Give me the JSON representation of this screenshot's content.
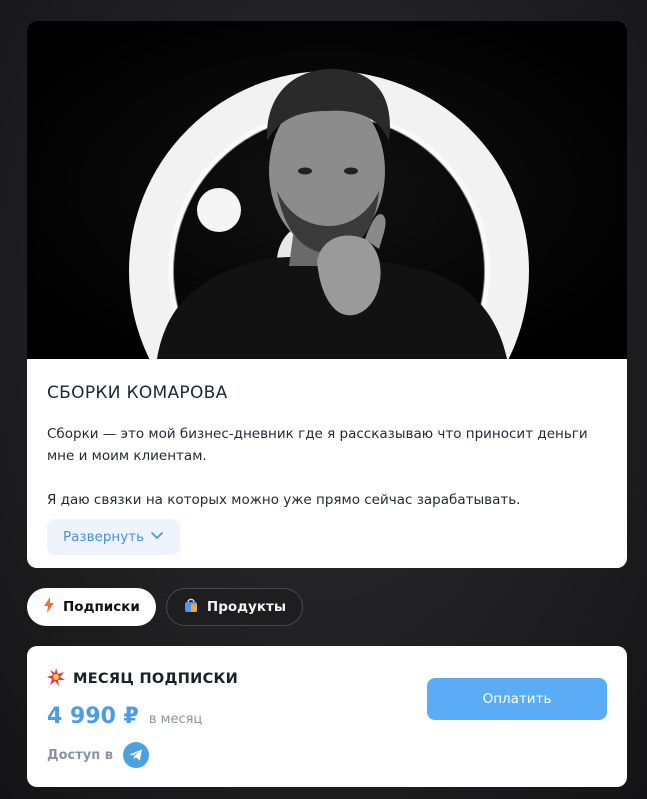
{
  "channel": {
    "title": "СБОРКИ КОМАРОВА",
    "description": "Сборки — это мой бизнес-дневник где я рассказываю что приносит деньги мне и моим клиентам.\n\nЯ даю связки на которых можно уже прямо сейчас зарабатывать.",
    "expand_label": "Развернуть",
    "cover_image": "portrait-photo"
  },
  "tabs": [
    {
      "label": "Подписки",
      "icon": "lightning-icon",
      "active": true
    },
    {
      "label": "Продукты",
      "icon": "shopping-bag-icon",
      "active": false
    }
  ],
  "plan": {
    "title": "МЕСЯЦ ПОДПИСКИ",
    "icon": "burst-icon",
    "price": "4 990 ₽",
    "period": "в месяц",
    "access_label": "Доступ в",
    "access_icon": "telegram-icon",
    "pay_label": "Оплатить"
  },
  "colors": {
    "accent": "#5aacf6",
    "price": "#4c9bea",
    "background": "#1c1c1e"
  }
}
